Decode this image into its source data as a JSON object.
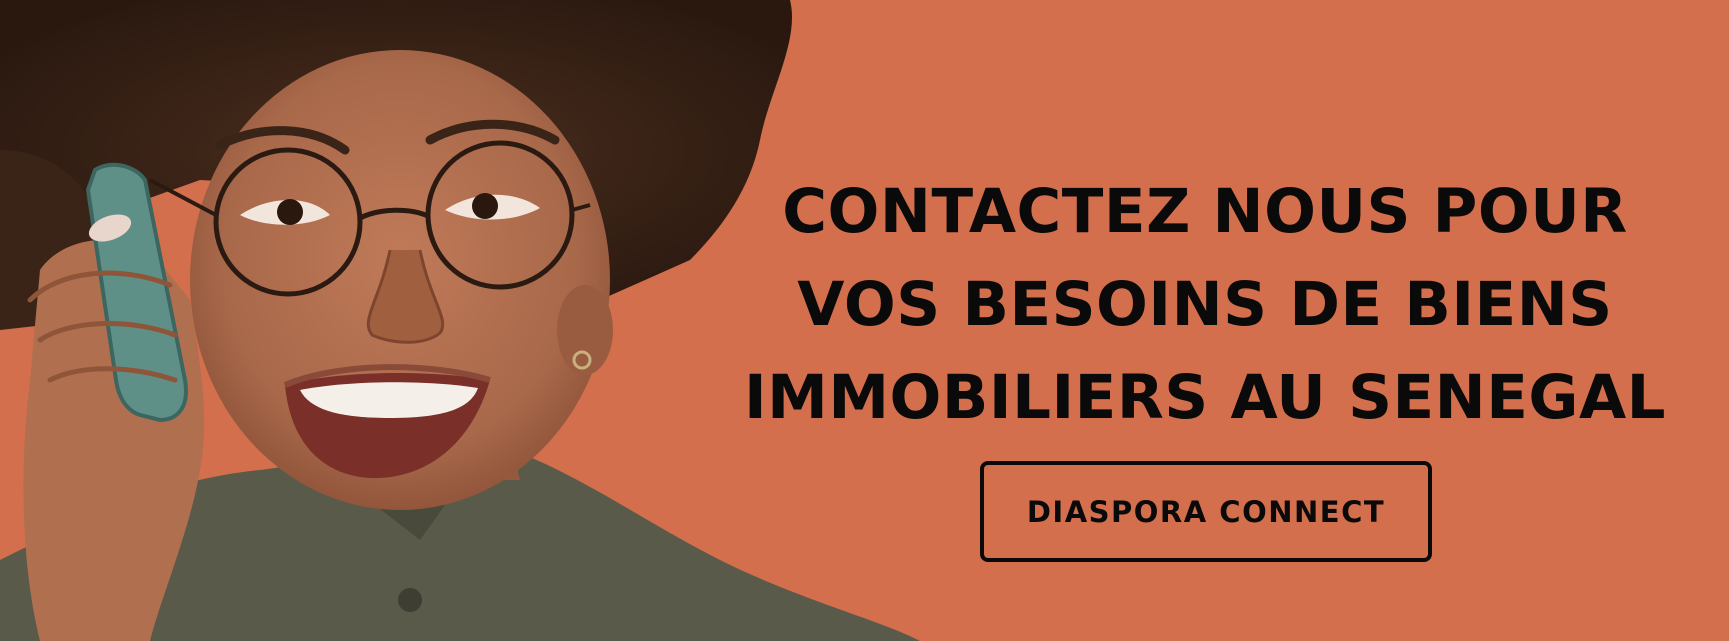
{
  "colors": {
    "background": "#d46f4d",
    "text": "#0a0a0a",
    "hair": "#3a2418",
    "skin": "#a8684a",
    "shirt": "#5a5a4a",
    "phone": "#5f9088"
  },
  "headline": {
    "lines": [
      "CONTACTEZ NOUS POUR",
      "VOS BESOINS DE BIENS",
      "IMMOBILIERS AU SENEGAL"
    ]
  },
  "cta": {
    "label": "DIASPORA CONNECT"
  },
  "photo": {
    "icon": "woman-on-phone-photo"
  }
}
